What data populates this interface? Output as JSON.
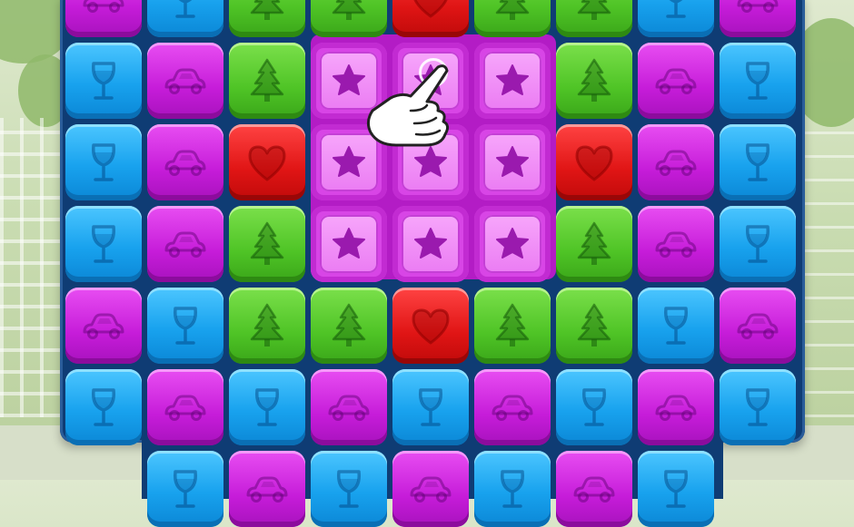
{
  "game": {
    "board": {
      "rows": [
        [
          "purple-car",
          "blue-glass",
          "green-tree",
          "green-tree",
          "red-heart",
          "green-tree",
          "green-tree",
          "blue-glass",
          "purple-car"
        ],
        [
          "blue-glass",
          "purple-car",
          "green-tree",
          "star",
          "star",
          "star",
          "green-tree",
          "purple-car",
          "blue-glass"
        ],
        [
          "blue-glass",
          "purple-car",
          "red-heart",
          "star",
          "star",
          "star",
          "red-heart",
          "purple-car",
          "blue-glass"
        ],
        [
          "blue-glass",
          "purple-car",
          "green-tree",
          "star",
          "star",
          "star",
          "green-tree",
          "purple-car",
          "blue-glass"
        ],
        [
          "purple-car",
          "blue-glass",
          "green-tree",
          "green-tree",
          "red-heart",
          "green-tree",
          "green-tree",
          "blue-glass",
          "purple-car"
        ],
        [
          "blue-glass",
          "purple-car",
          "blue-glass",
          "purple-car",
          "blue-glass",
          "purple-car",
          "blue-glass",
          "purple-car",
          "blue-glass"
        ],
        [
          "",
          "blue-glass",
          "purple-car",
          "blue-glass",
          "purple-car",
          "blue-glass",
          "purple-car",
          "blue-glass",
          ""
        ]
      ]
    },
    "tile_types": {
      "blue-glass": {
        "color": "#18a2ee",
        "icon": "wine-glass-icon"
      },
      "purple-car": {
        "color": "#c61cd9",
        "icon": "car-icon"
      },
      "green-tree": {
        "color": "#4fc426",
        "icon": "pine-tree-icon"
      },
      "red-heart": {
        "color": "#e01515",
        "icon": "heart-icon"
      },
      "star": {
        "color": "#eb7cf3",
        "icon": "star-icon"
      }
    },
    "tutorial_pointer": {
      "icon": "pointing-hand-icon",
      "target_row": 1,
      "target_col": 4
    }
  }
}
